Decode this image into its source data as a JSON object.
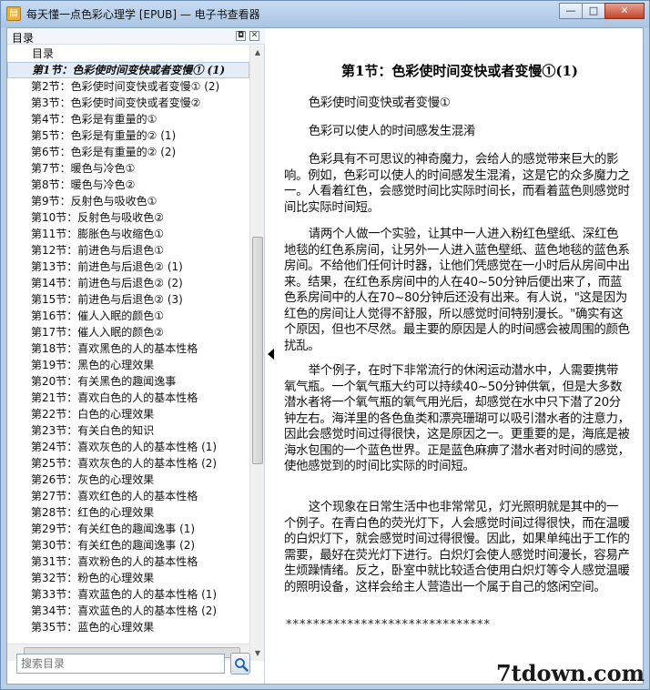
{
  "window": {
    "title": "每天懂一点色彩心理学 [EPUB] — 电子书查看器",
    "minimize": "—",
    "maximize": "□",
    "close": "✕"
  },
  "sidebar": {
    "header": "目录",
    "pin_icon": "◘",
    "close_icon": "✕",
    "root": "目录",
    "items": [
      "第1节：色彩使时间变快或者变慢① (1)",
      "第2节：色彩使时间变快或者变慢① (2)",
      "第3节：色彩使时间变快或者变慢②",
      "第4节：色彩是有重量的①",
      "第5节：色彩是有重量的② (1)",
      "第6节：色彩是有重量的② (2)",
      "第7节：暖色与冷色①",
      "第8节：暖色与冷色②",
      "第9节：反射色与吸收色①",
      "第10节：反射色与吸收色②",
      "第11节：膨胀色与收缩色①",
      "第12节：前进色与后退色①",
      "第13节：前进色与后退色② (1)",
      "第14节：前进色与后退色② (2)",
      "第15节：前进色与后退色② (3)",
      "第16节：催人入眠的颜色①",
      "第17节：催人入眠的颜色②",
      "第18节：喜欢黑色的人的基本性格",
      "第19节：黑色的心理效果",
      "第20节：有关黑色的趣闻逸事",
      "第21节：喜欢白色的人的基本性格",
      "第22节：白色的心理效果",
      "第23节：有关白色的知识",
      "第24节：喜欢灰色的人的基本性格 (1)",
      "第25节：喜欢灰色的人的基本性格 (2)",
      "第26节：灰色的心理效果",
      "第27节：喜欢红色的人的基本性格",
      "第28节：红色的心理效果",
      "第29节：有关红色的趣闻逸事 (1)",
      "第30节：有关红色的趣闻逸事 (2)",
      "第31节：喜欢粉色的人的基本性格",
      "第32节：粉色的心理效果",
      "第33节：喜欢蓝色的人的基本性格 (1)",
      "第34节：喜欢蓝色的人的基本性格 (2)",
      "第35节：蓝色的心理效果"
    ],
    "search_placeholder": "搜索目录"
  },
  "reader": {
    "chapter_title": "第1节：色彩使时间变快或者变慢①(1)",
    "paragraphs": [
      "色彩使时间变快或者变慢①",
      "色彩可以使人的时间感发生混淆",
      "色彩具有不可思议的神奇魔力，会给人的感觉带来巨大的影响。例如，色彩可以使人的时间感发生混淆，这是它的众多魔力之一。人看着红色，会感觉时间比实际时间长，而看着蓝色则感觉时间比实际时间短。",
      "请两个人做一个实验，让其中一人进入粉红色壁纸、深红色地毯的红色系房间，让另外一人进入蓝色壁纸、蓝色地毯的蓝色系房间。不给他们任何计时器，让他们凭感觉在一小时后从房间中出来。结果，在红色系房间中的人在40~50分钟后便出来了，而蓝色系房间中的人在70~80分钟后还没有出来。有人说，\"这是因为红色的房间让人觉得不舒服，所以感觉时间特别漫长。\"确实有这个原因，但也不尽然。最主要的原因是人的时间感会被周围的颜色扰乱。",
      "举个例子，在时下非常流行的休闲运动潜水中，人需要携带氧气瓶。一个氧气瓶大约可以持续40~50分钟供氧，但是大多数潜水者将一个氧气瓶的氧气用光后，却感觉在水中只下潜了20分钟左右。海洋里的各色鱼类和漂亮珊瑚可以吸引潜水者的注意力，因此会感觉时间过得很快，这是原因之一。更重要的是，海底是被海水包围的一个蓝色世界。正是蓝色麻痹了潜水者对时间的感觉，使他感觉到的时间比实际的时间短。",
      "这个现象在日常生活中也非常常见，灯光照明就是其中的一个例子。在青白色的荧光灯下，人会感觉时间过得很快，而在温暖的白炽灯下，就会感觉时间过得很慢。因此，如果单纯出于工作的需要，最好在荧光灯下进行。白炽灯会使人感觉时间漫长，容易产生烦躁情绪。反之，卧室中就比较适合使用白炽灯等令人感觉温暖的照明设备，这样会给主人营造出一个属于自己的悠闲空间。"
    ],
    "separator": "******************************"
  },
  "watermark": "7tdown.com"
}
